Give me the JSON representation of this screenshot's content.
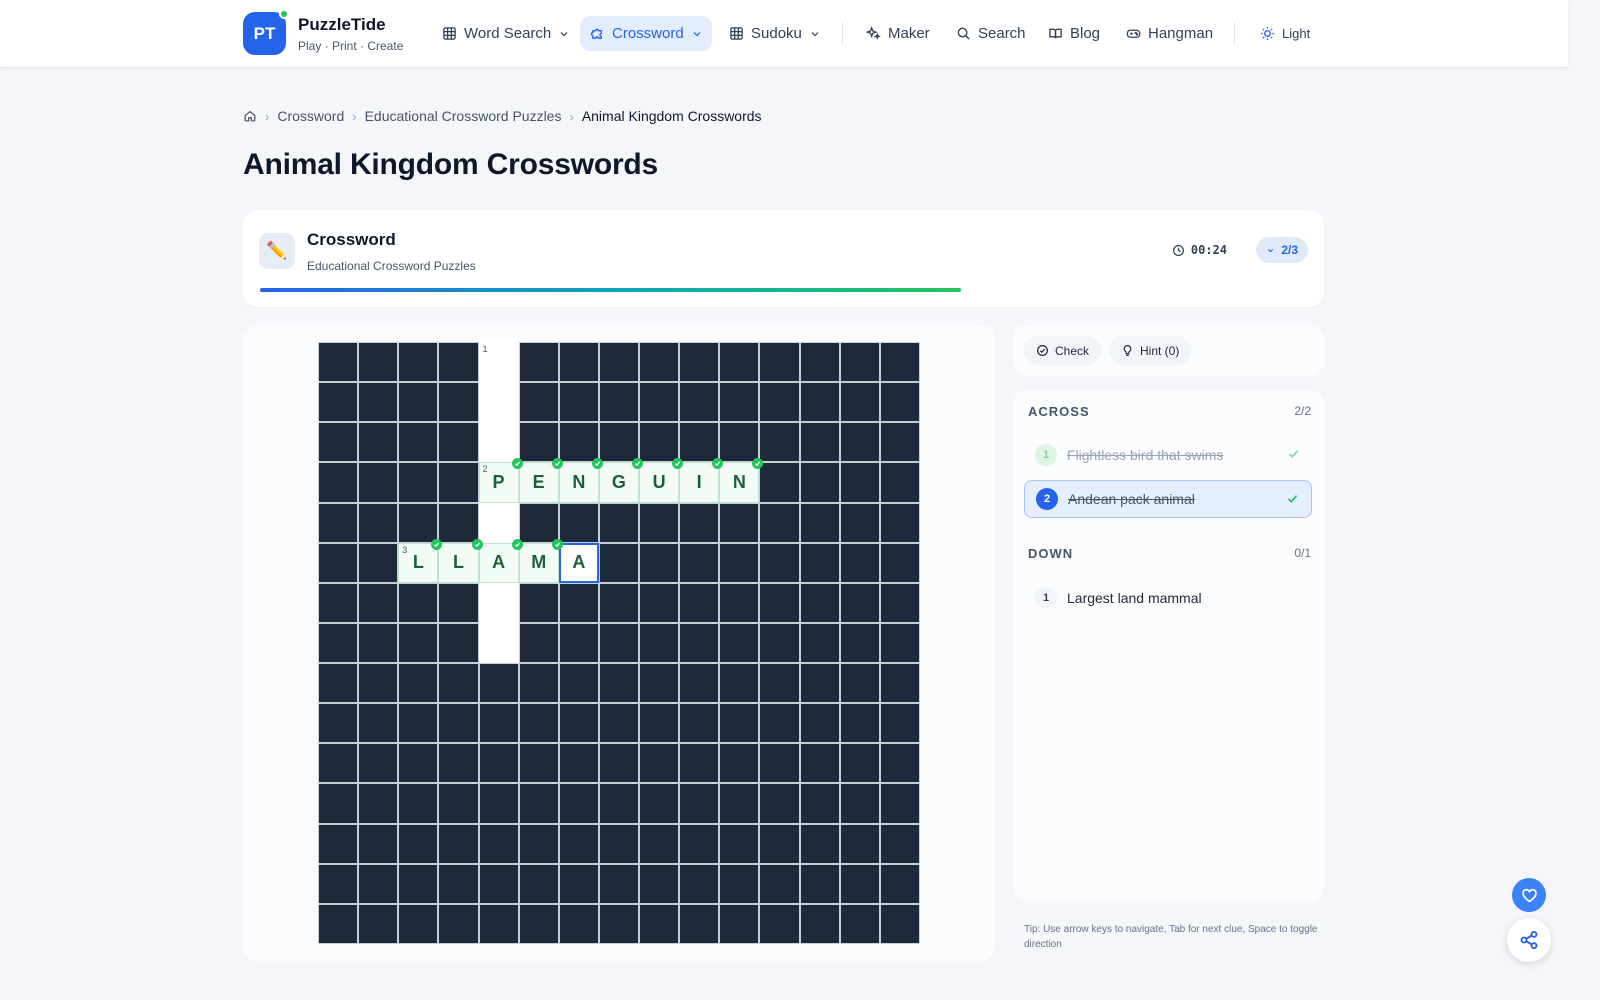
{
  "brand": {
    "initials": "PT",
    "name": "PuzzleTide",
    "tagline": "Play · Print · Create"
  },
  "nav": {
    "word_search": "Word Search",
    "crossword": "Crossword",
    "sudoku": "Sudoku",
    "maker": "Maker",
    "search": "Search",
    "blog": "Blog",
    "hangman": "Hangman",
    "theme": "Light"
  },
  "breadcrumb": {
    "crossword": "Crossword",
    "category": "Educational Crossword Puzzles",
    "current": "Animal Kingdom Crosswords"
  },
  "page": {
    "title": "Animal Kingdom Crosswords"
  },
  "puzzle": {
    "title": "Crossword",
    "subtitle": "Educational Crossword Puzzles",
    "timer": "00:24",
    "progress": "2/3",
    "progress_fraction": 0.67
  },
  "tools": {
    "check": "Check",
    "hint": "Hint (0)"
  },
  "clues": {
    "across_label": "ACROSS",
    "across_count": "2/2",
    "down_label": "DOWN",
    "down_count": "0/1",
    "across": [
      {
        "number": "1",
        "text": "Flightless bird that swims"
      },
      {
        "number": "2",
        "text": "Andean pack animal"
      }
    ],
    "down": [
      {
        "number": "1",
        "text": "Largest land mammal"
      }
    ]
  },
  "tip": "Tip: Use arrow keys to navigate, Tab for next clue, Space to toggle direction",
  "grid": {
    "size": 15,
    "cells": [
      {
        "row": 0,
        "col": 4,
        "letter": "",
        "number": "1"
      },
      {
        "row": 1,
        "col": 4,
        "letter": ""
      },
      {
        "row": 2,
        "col": 4,
        "letter": ""
      },
      {
        "row": 3,
        "col": 4,
        "letter": "P",
        "number": "2",
        "state": "done"
      },
      {
        "row": 3,
        "col": 5,
        "letter": "E",
        "state": "done"
      },
      {
        "row": 3,
        "col": 6,
        "letter": "N",
        "state": "done"
      },
      {
        "row": 3,
        "col": 7,
        "letter": "G",
        "state": "done"
      },
      {
        "row": 3,
        "col": 8,
        "letter": "U",
        "state": "done"
      },
      {
        "row": 3,
        "col": 9,
        "letter": "I",
        "state": "done"
      },
      {
        "row": 3,
        "col": 10,
        "letter": "N",
        "state": "done"
      },
      {
        "row": 4,
        "col": 4,
        "letter": ""
      },
      {
        "row": 5,
        "col": 2,
        "letter": "L",
        "number": "3",
        "state": "done"
      },
      {
        "row": 5,
        "col": 3,
        "letter": "L",
        "state": "done"
      },
      {
        "row": 5,
        "col": 4,
        "letter": "A",
        "state": "done"
      },
      {
        "row": 5,
        "col": 5,
        "letter": "M",
        "state": "done"
      },
      {
        "row": 5,
        "col": 6,
        "letter": "A",
        "state": "current"
      },
      {
        "row": 6,
        "col": 4,
        "letter": ""
      },
      {
        "row": 7,
        "col": 4,
        "letter": ""
      }
    ]
  }
}
